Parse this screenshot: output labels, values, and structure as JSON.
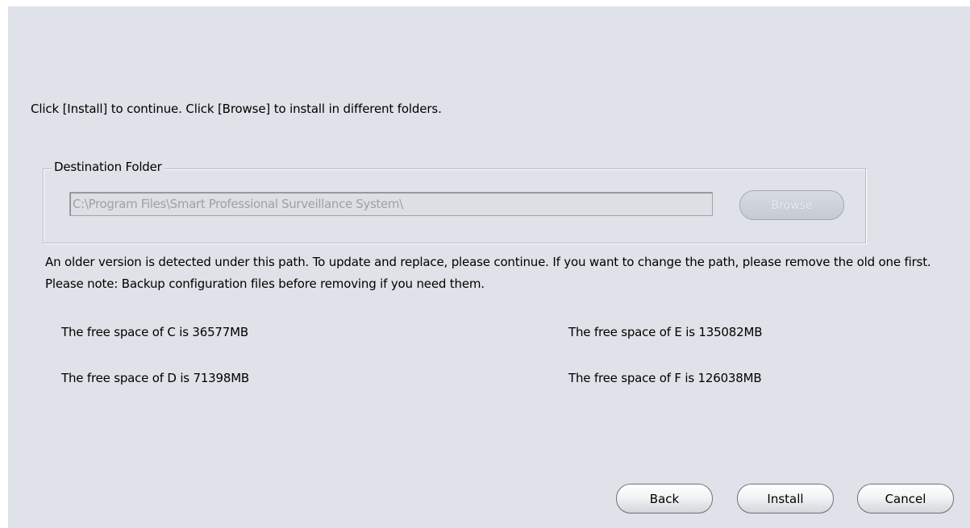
{
  "instruction": "Click [Install] to continue. Click [Browse] to install in different folders.",
  "destination": {
    "legend": "Destination Folder",
    "path_value": "C:\\Program Files\\Smart Professional Surveillance System\\",
    "browse_label": "Browse",
    "browse_enabled": false
  },
  "note": "An older version is detected under this path. To update and replace, please continue. If you want to change the path, please remove the old one first. Please note: Backup configuration files before removing if you need them.",
  "free_space": {
    "c": "The free space of C is 36577MB",
    "d": "The free space of D is 71398MB",
    "e": "The free space of E is 135082MB",
    "f": "The free space of F is 126038MB"
  },
  "buttons": {
    "back": "Back",
    "install": "Install",
    "cancel": "Cancel"
  },
  "colors": {
    "panel_background": "#dfe2e8",
    "disabled_text": "#9da1a8"
  }
}
